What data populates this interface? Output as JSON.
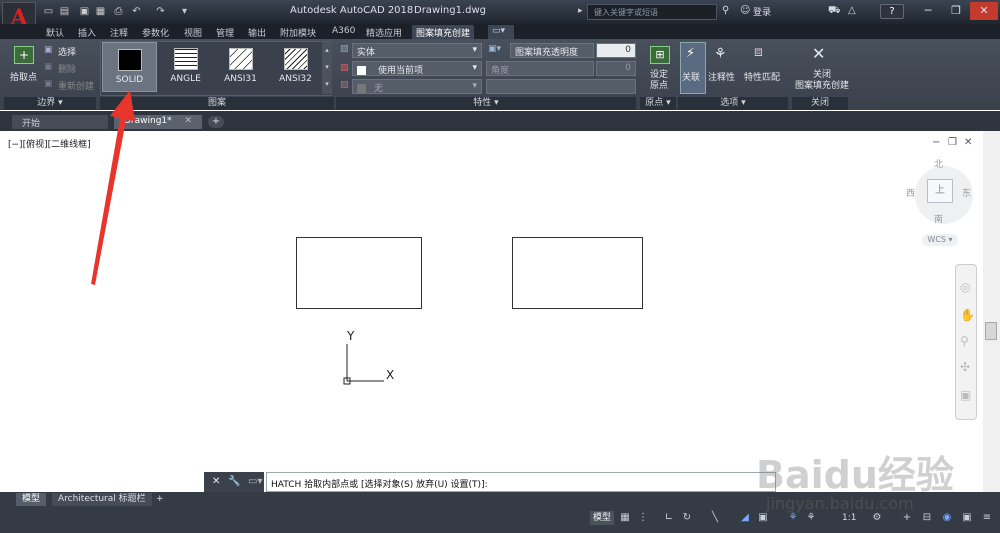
{
  "titlebar": {
    "app_title": "Autodesk AutoCAD 2018",
    "doc_title": "Drawing1.dwg",
    "search_placeholder": "键入关键字或短语",
    "login": "登录",
    "help": "?"
  },
  "ribbon_tabs": [
    "默认",
    "插入",
    "注释",
    "参数化",
    "视图",
    "管理",
    "输出",
    "附加模块",
    "A360",
    "精选应用",
    "图案填充创建"
  ],
  "ribbon": {
    "boundary": {
      "pick_point": "拾取点",
      "select": "选择",
      "remove": "删除",
      "recreate": "重新创建",
      "label": "边界"
    },
    "pattern": {
      "items": [
        "SOLID",
        "ANGLE",
        "ANSI31",
        "ANSI32"
      ],
      "label": "图案"
    },
    "properties": {
      "type": "实体",
      "color": "使用当前项",
      "bgcolor": "无",
      "transparency_label": "图案填充透明度",
      "transparency_value": "0",
      "angle_label": "角度",
      "angle_value": "0",
      "label": "特性"
    },
    "origin": {
      "set_origin": "设定\n原点",
      "label": "原点"
    },
    "options": {
      "associative": "关联",
      "annotative": "注释性",
      "match": "特性匹配",
      "label": "选项"
    },
    "close": {
      "btn": "关闭\n图案填充创建",
      "label": "关闭"
    }
  },
  "doc_tabs": [
    "开始",
    "Drawing1*"
  ],
  "viewport_label": "[−][俯视][二维线框]",
  "viewcube": {
    "north": "北",
    "south": "南",
    "east": "东",
    "west": "西",
    "wcs": "WCS"
  },
  "ucs": {
    "x": "X",
    "y": "Y"
  },
  "command": {
    "text": "HATCH 拾取内部点或 [选择对象(S) 放弃(U) 设置(T)]:"
  },
  "layout_tabs": [
    "模型",
    "Architectural 标题栏"
  ],
  "status": {
    "model": "模型",
    "scale": "1:1"
  },
  "watermark": {
    "brand": "Baidu经验",
    "url": "jingyan.baidu.com"
  },
  "colors": {
    "accent": "#e02020",
    "ribbon": "#424953",
    "arrow": "#e8352b"
  }
}
